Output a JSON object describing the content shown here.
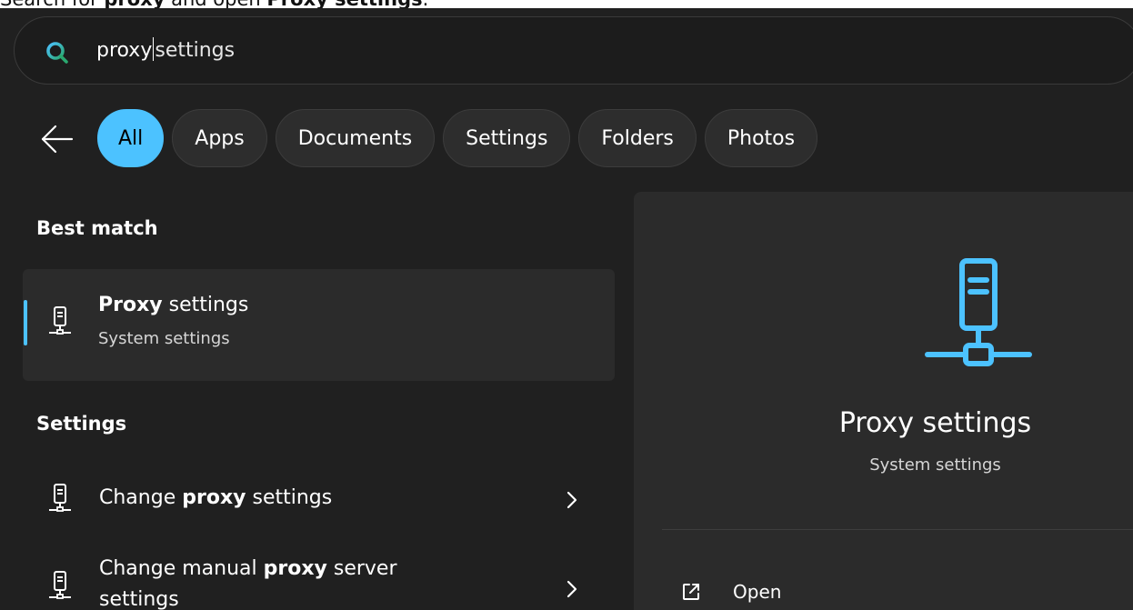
{
  "caption": {
    "prefix": "Search for ",
    "term": "proxy",
    "middle": " and open ",
    "target": "Proxy settings",
    "suffix": "."
  },
  "search": {
    "typed": "proxy",
    "suggestion": "settings"
  },
  "filters": [
    "All",
    "Apps",
    "Documents",
    "Settings",
    "Folders",
    "Photos"
  ],
  "best_match": {
    "heading": "Best match",
    "item": {
      "title_bold": "Proxy",
      "title_rest": " settings",
      "subtitle": "System settings"
    }
  },
  "settings_section": {
    "heading": "Settings",
    "items": [
      {
        "pre": "Change ",
        "bold": "proxy",
        "post": " settings"
      },
      {
        "pre": "Change manual ",
        "bold": "proxy",
        "post": " server",
        "line2": "settings"
      }
    ]
  },
  "detail": {
    "title": "Proxy settings",
    "subtitle": "System settings",
    "actions": [
      {
        "label": "Open",
        "icon": "open-external-icon"
      }
    ]
  },
  "colors": {
    "accent": "#4cc2ff",
    "background": "#202020",
    "panel": "#2b2b2b"
  }
}
